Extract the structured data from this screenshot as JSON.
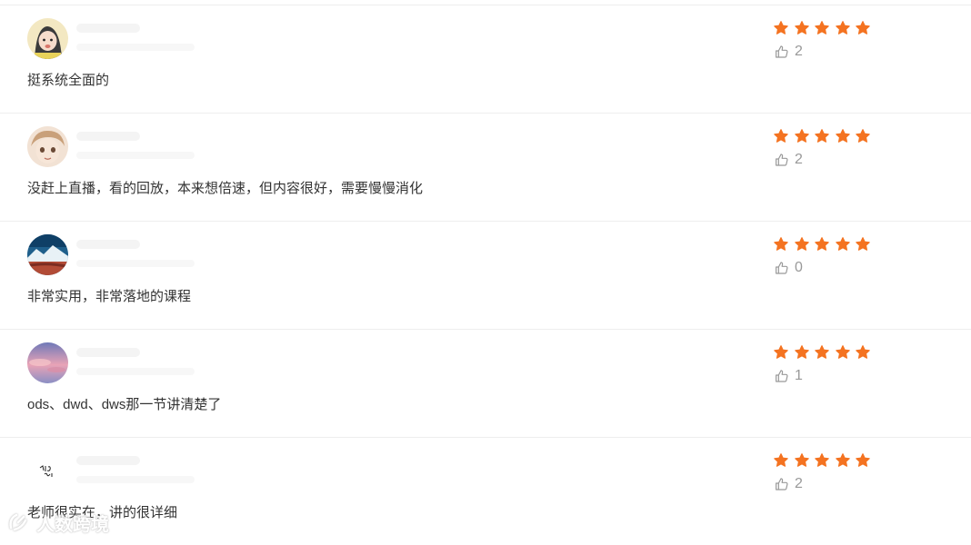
{
  "reviews": [
    {
      "comment": "挺系统全面的",
      "rating": 5,
      "likes": "2",
      "avatar_icon": "cartoon-girl-avatar",
      "avatar_colors": [
        "#f3e8c2",
        "#3b3b3b",
        "#e9b7a6"
      ]
    },
    {
      "comment": "没赶上直播，看的回放，本来想倍速，但内容很好，需要慢慢消化",
      "rating": 5,
      "likes": "2",
      "avatar_icon": "anime-face-avatar",
      "avatar_colors": [
        "#f2e2d4",
        "#c9a07a",
        "#6b4a36"
      ]
    },
    {
      "comment": "非常实用，非常落地的课程",
      "rating": 5,
      "likes": "0",
      "avatar_icon": "mountain-landscape-avatar",
      "avatar_colors": [
        "#1f5f8b",
        "#e8f1f6",
        "#b24b36"
      ]
    },
    {
      "comment": "ods、dwd、dws那一节讲清楚了",
      "rating": 5,
      "likes": "1",
      "avatar_icon": "sunset-sky-avatar",
      "avatar_colors": [
        "#8a8fc4",
        "#e9a3b6",
        "#6f79b8"
      ]
    },
    {
      "comment": "老师很实在，讲的很详细",
      "rating": 5,
      "likes": "2",
      "avatar_icon": "handwriting-avatar",
      "avatar_colors": [
        "#ffffff",
        "#222222",
        "#dddddd"
      ]
    }
  ],
  "star_color": "#f47321",
  "like_icon": "thumbs-up-icon",
  "watermark": {
    "text": "人数跨境",
    "logo_icon": "brand-logo-icon"
  }
}
